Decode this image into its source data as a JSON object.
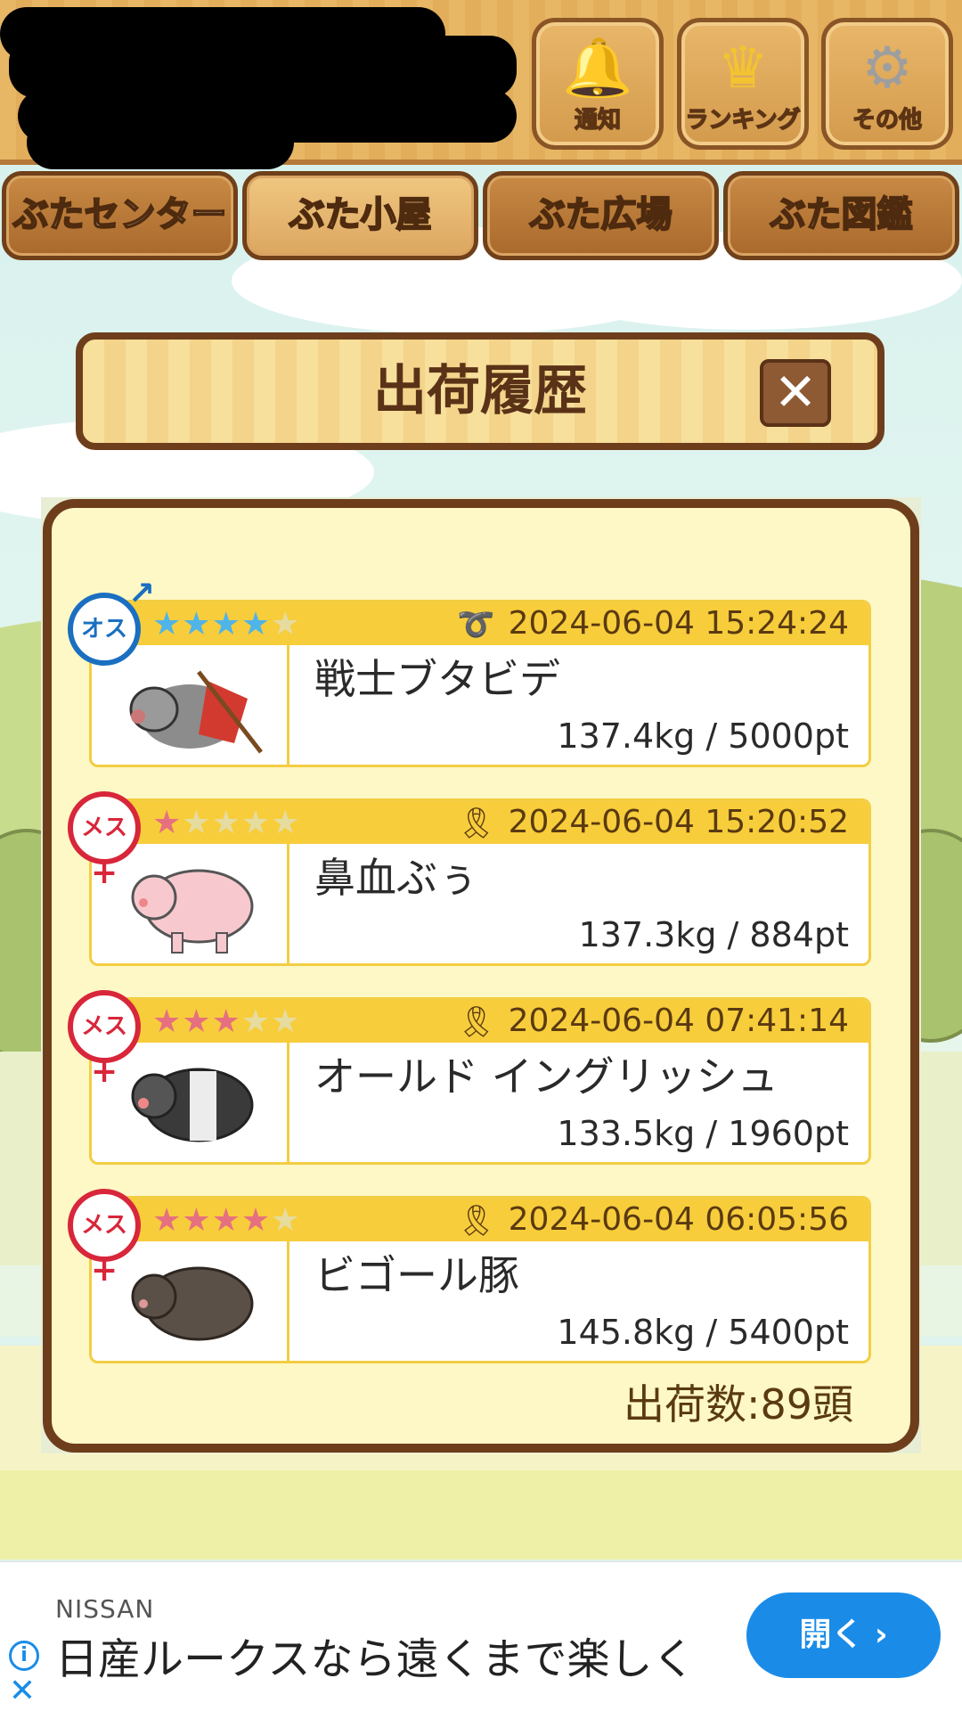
{
  "topbar": {
    "buttons": [
      {
        "label": "通知",
        "icon": "bell-icon"
      },
      {
        "label": "ランキング",
        "icon": "crown-icon"
      },
      {
        "label": "その他",
        "icon": "gear-icon"
      }
    ]
  },
  "nav": {
    "tabs": [
      {
        "label": "ぶたセンター",
        "active": false
      },
      {
        "label": "ぶた小屋",
        "active": true
      },
      {
        "label": "ぶた広場",
        "active": false
      },
      {
        "label": "ぶた図鑑",
        "active": false
      }
    ]
  },
  "panel": {
    "title": "出荷履歴",
    "close_label": "✕",
    "items": [
      {
        "gender": "オス",
        "gender_type": "male",
        "stars": 4,
        "max_stars": 5,
        "star_color": "#4fb4e8",
        "rank_icon": "lasso-icon",
        "date": "2024-06-04 15:24:24",
        "name": "戦士ブタビデ",
        "weight": "137.4kg / 5000pt"
      },
      {
        "gender": "メス",
        "gender_type": "female",
        "stars": 1,
        "max_stars": 5,
        "star_color": "#e6707f",
        "rank_icon": "ribbon-icon",
        "date": "2024-06-04 15:20:52",
        "name": "鼻血ぶぅ",
        "weight": "137.3kg / 884pt"
      },
      {
        "gender": "メス",
        "gender_type": "female",
        "stars": 3,
        "max_stars": 5,
        "star_color": "#e6707f",
        "rank_icon": "ribbon-icon",
        "date": "2024-06-04 07:41:14",
        "name": "オールド イングリッシュ",
        "weight": "133.5kg / 1960pt"
      },
      {
        "gender": "メス",
        "gender_type": "female",
        "stars": 4,
        "max_stars": 5,
        "star_color": "#e6707f",
        "rank_icon": "ribbon-icon",
        "date": "2024-06-04 06:05:56",
        "name": "ビゴール豚",
        "weight": "145.8kg / 5400pt"
      }
    ],
    "shipped_count": "出荷数:89頭"
  },
  "ad": {
    "brand": "NISSAN",
    "headline": "日産ルークスなら遠くまで楽しく",
    "cta": "開く ›"
  },
  "colors": {
    "accent_yellow": "#f7cd3c",
    "frame_brown": "#6e3e1c",
    "ad_blue": "#1a8ce8"
  }
}
